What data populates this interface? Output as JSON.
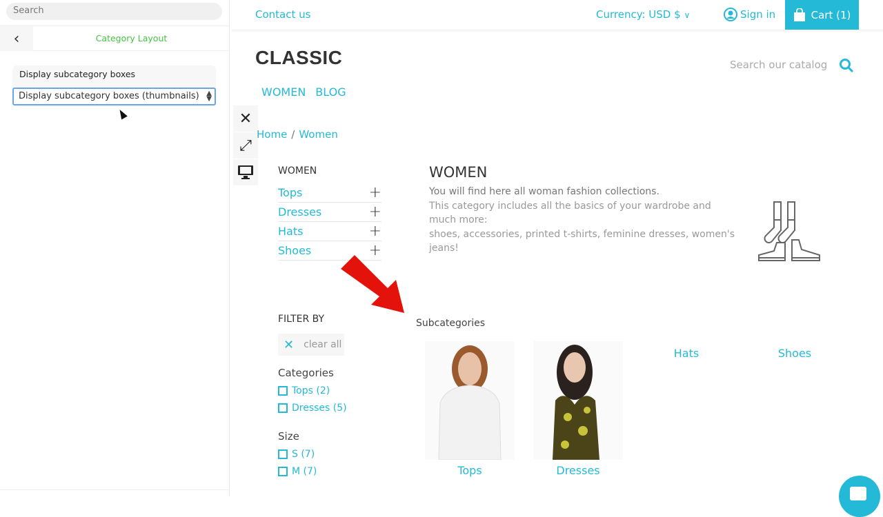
{
  "panel": {
    "search_placeholder": "Search",
    "title": "Category Layout",
    "field_label": "Display subcategory boxes",
    "field_value": "Display subcategory boxes (thumbnails)"
  },
  "colors": {
    "accent": "#24b9d7",
    "panel_title": "#43c443",
    "arrow": "#e3120b"
  },
  "topbar": {
    "contact": "Contact us",
    "currency": "Currency: USD $",
    "signin": "Sign in",
    "cart": "Cart (1)"
  },
  "header": {
    "logo": "CLASSIC",
    "search_placeholder": "Search our catalog",
    "menu": [
      "WOMEN",
      "BLOG"
    ]
  },
  "breadcrumb": [
    "Home",
    "Women"
  ],
  "sidebar": {
    "title": "WOMEN",
    "items": [
      "Tops",
      "Dresses",
      "Hats",
      "Shoes"
    ]
  },
  "category": {
    "title": "WOMEN",
    "desc_first": "You will find here all woman fashion collections.",
    "desc_rest": "This category includes all the basics of your wardrobe and much more:",
    "desc_last": "shoes, accessories, printed t-shirts, feminine dresses, women's jeans!"
  },
  "filter": {
    "title": "FILTER BY",
    "clear": "clear all",
    "groups": [
      {
        "label": "Categories",
        "options": [
          "Tops (2)",
          "Dresses (5)"
        ]
      },
      {
        "label": "Size",
        "options": [
          "S (7)",
          "M (7)"
        ]
      }
    ]
  },
  "subcategories": {
    "title": "Subcategories",
    "items": [
      "Tops",
      "Dresses",
      "Hats",
      "Shoes"
    ]
  }
}
